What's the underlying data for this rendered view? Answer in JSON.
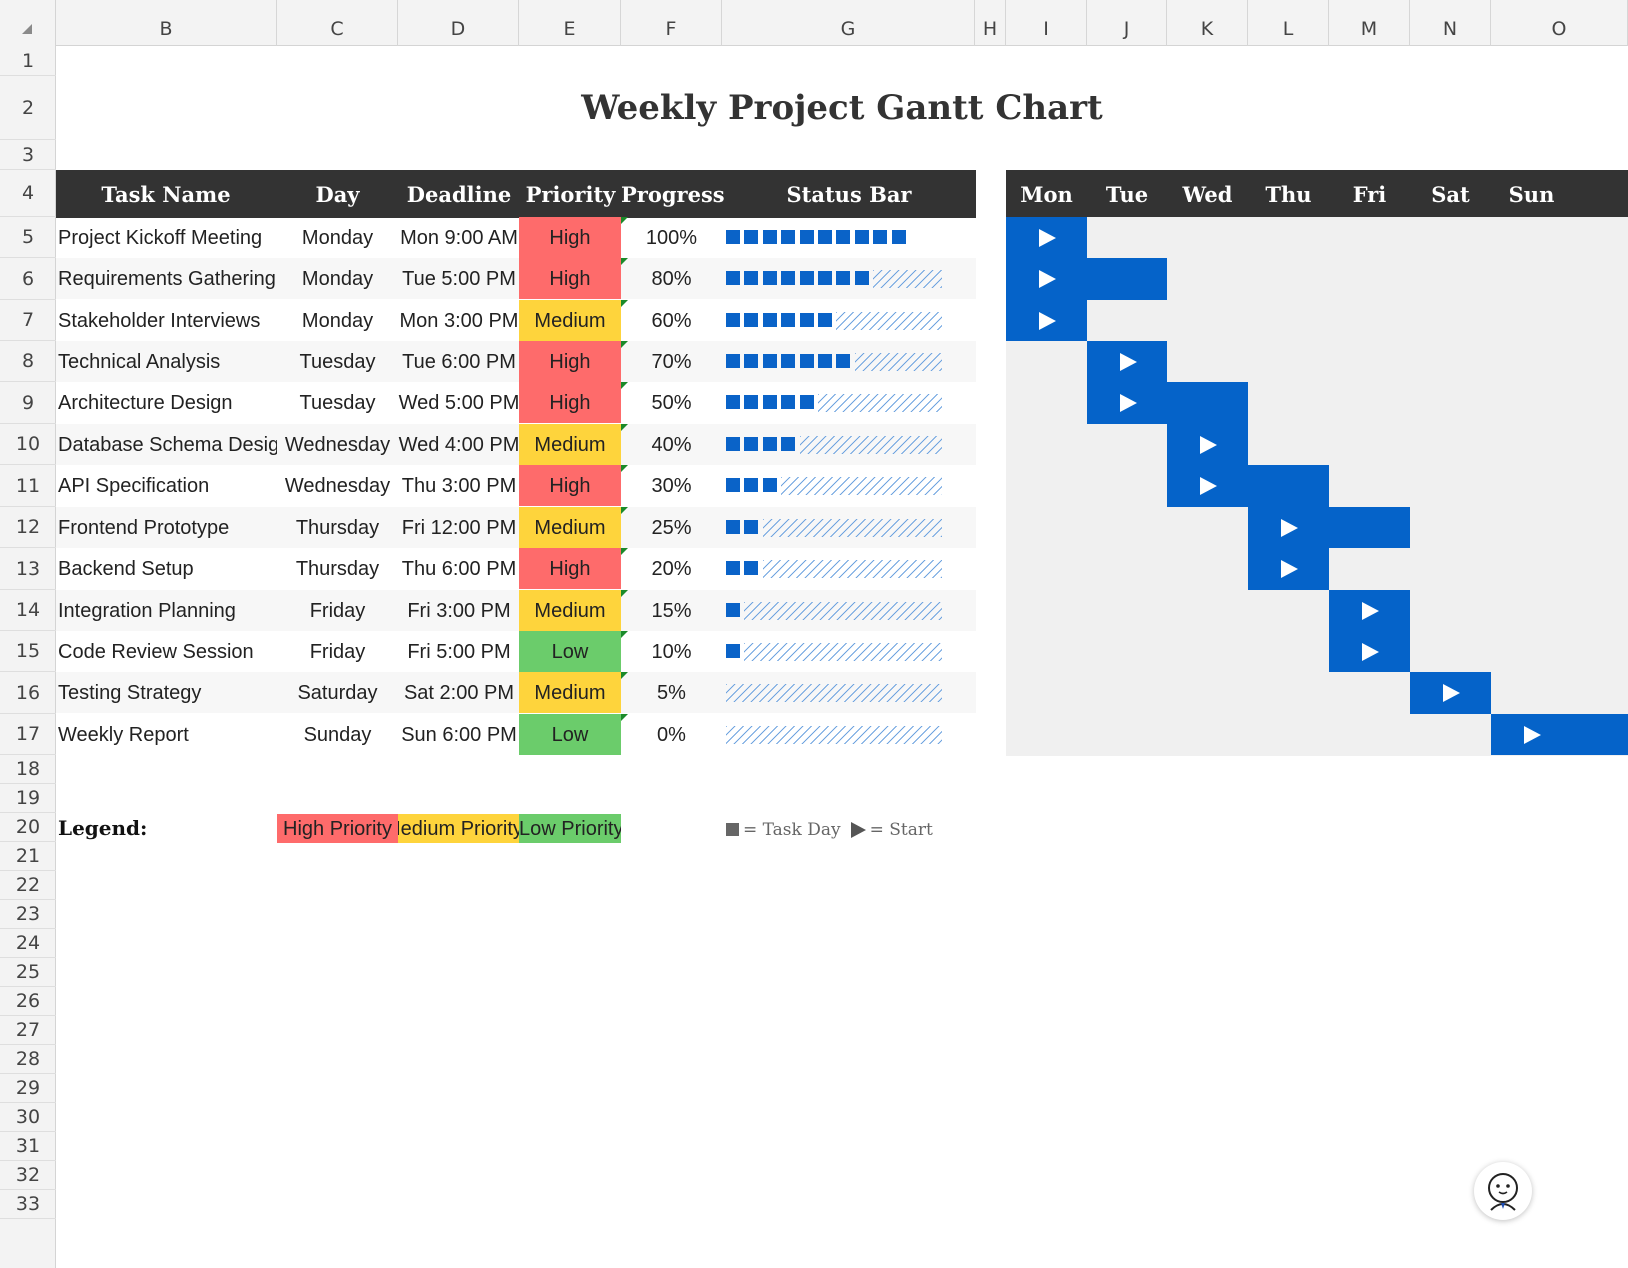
{
  "columns": [
    "B",
    "C",
    "D",
    "E",
    "F",
    "G",
    "H",
    "I",
    "J",
    "K",
    "L",
    "M",
    "N",
    "O"
  ],
  "rows": [
    "1",
    "2",
    "3",
    "4",
    "5",
    "6",
    "7",
    "8",
    "9",
    "10",
    "11",
    "12",
    "13",
    "14",
    "15",
    "16",
    "17",
    "18",
    "19",
    "20",
    "21",
    "22",
    "23",
    "24",
    "25",
    "26",
    "27",
    "28",
    "29",
    "30",
    "31",
    "32",
    "33"
  ],
  "title": "Weekly Project Gantt Chart",
  "headers": {
    "task": "Task Name",
    "day": "Day",
    "deadline": "Deadline",
    "priority": "Priority",
    "progress": "Progress",
    "status": "Status Bar"
  },
  "days": [
    "Mon",
    "Tue",
    "Wed",
    "Thu",
    "Fri",
    "Sat",
    "Sun"
  ],
  "tasks": [
    {
      "name": "Project Kickoff Meeting",
      "day": "Monday",
      "deadline": "Mon 9:00 AM",
      "priority": "High",
      "progress": "100%",
      "progress_value": 100
    },
    {
      "name": "Requirements Gathering",
      "day": "Monday",
      "deadline": "Tue 5:00 PM",
      "priority": "High",
      "progress": "80%",
      "progress_value": 80
    },
    {
      "name": "Stakeholder Interviews",
      "day": "Monday",
      "deadline": "Mon 3:00 PM",
      "priority": "Medium",
      "progress": "60%",
      "progress_value": 60
    },
    {
      "name": "Technical Analysis",
      "day": "Tuesday",
      "deadline": "Tue 6:00 PM",
      "priority": "High",
      "progress": "70%",
      "progress_value": 70
    },
    {
      "name": "Architecture Design",
      "day": "Tuesday",
      "deadline": "Wed 5:00 PM",
      "priority": "High",
      "progress": "50%",
      "progress_value": 50
    },
    {
      "name": "Database Schema Design",
      "day": "Wednesday",
      "deadline": "Wed 4:00 PM",
      "priority": "Medium",
      "progress": "40%",
      "progress_value": 40
    },
    {
      "name": "API Specification",
      "day": "Wednesday",
      "deadline": "Thu 3:00 PM",
      "priority": "High",
      "progress": "30%",
      "progress_value": 30
    },
    {
      "name": "Frontend Prototype",
      "day": "Thursday",
      "deadline": "Fri 12:00 PM",
      "priority": "Medium",
      "progress": "25%",
      "progress_value": 25
    },
    {
      "name": "Backend Setup",
      "day": "Thursday",
      "deadline": "Thu 6:00 PM",
      "priority": "High",
      "progress": "20%",
      "progress_value": 20
    },
    {
      "name": "Integration Planning",
      "day": "Friday",
      "deadline": "Fri 3:00 PM",
      "priority": "Medium",
      "progress": "15%",
      "progress_value": 15
    },
    {
      "name": "Code Review Session",
      "day": "Friday",
      "deadline": "Fri 5:00 PM",
      "priority": "Low",
      "progress": "10%",
      "progress_value": 10
    },
    {
      "name": "Testing Strategy",
      "day": "Saturday",
      "deadline": "Sat 2:00 PM",
      "priority": "Medium",
      "progress": "5%",
      "progress_value": 5
    },
    {
      "name": "Weekly Report",
      "day": "Sunday",
      "deadline": "Sun 6:00 PM",
      "priority": "Low",
      "progress": "0%",
      "progress_value": 0
    }
  ],
  "gantt": [
    {
      "start": 0,
      "span": 1
    },
    {
      "start": 0,
      "span": 2
    },
    {
      "start": 0,
      "span": 1
    },
    {
      "start": 1,
      "span": 1
    },
    {
      "start": 1,
      "span": 2
    },
    {
      "start": 2,
      "span": 1
    },
    {
      "start": 2,
      "span": 2
    },
    {
      "start": 3,
      "span": 2
    },
    {
      "start": 3,
      "span": 1
    },
    {
      "start": 4,
      "span": 1
    },
    {
      "start": 4,
      "span": 1
    },
    {
      "start": 5,
      "span": 1
    },
    {
      "start": 6,
      "span": 1
    }
  ],
  "legend": {
    "label": "Legend:",
    "high": "High Priority",
    "medium": "Medium Priority",
    "low": "Low Priority",
    "task_day": "= Task Day",
    "start": "= Start"
  },
  "colors": {
    "header_bg": "#333333",
    "high": "#fe6b6b",
    "medium": "#fed43c",
    "low": "#6bcc6b",
    "gantt_blue": "#0563c9",
    "bar_blue": "#0a63c8"
  }
}
